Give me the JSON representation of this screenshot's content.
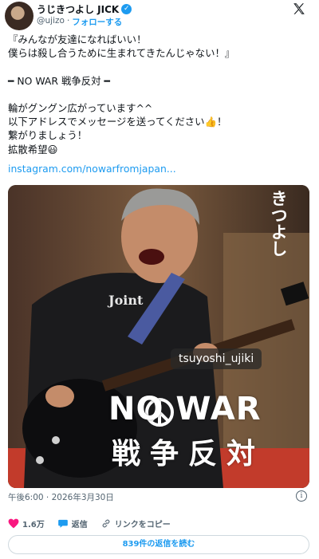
{
  "header": {
    "display_name": "うじきつよし JICK",
    "handle": "@ujizo",
    "separator": "·",
    "follow_label": "フォローする"
  },
  "tweet": {
    "text": "『みんなが友達になればいい！\n僕らは殺し合うために生まれてきたんじゃない！』\n\n━ NO WAR 戦争反対 ━\n\n輪がグングン広がっています^^\n以下アドレスでメッセージを送ってください👍！\n繋がりましょう！\n拡散希望😃",
    "link": "instagram.com/nowarfromjapan..."
  },
  "media": {
    "side_text": "きつよし",
    "user_tag": "tsuyoshi_ujiki",
    "shirt_text": "Joint",
    "no_war_text": "NO WAR",
    "no_war_jp": "戦争反対"
  },
  "meta": {
    "timestamp": "午後6:00 · 2026年3月30日",
    "info_glyph": "i"
  },
  "actions": {
    "likes": "1.6万",
    "reply_label": "返信",
    "copy_link_label": "リンクをコピー"
  },
  "footer": {
    "read_replies": "839件の返信を読む"
  },
  "colors": {
    "accent": "#1d9bf0",
    "like": "#f91880",
    "secondary_text": "#536471"
  },
  "icons": [
    "verified-badge-icon",
    "x-logo-icon",
    "info-icon",
    "heart-icon",
    "reply-icon",
    "link-icon",
    "peace-icon"
  ]
}
